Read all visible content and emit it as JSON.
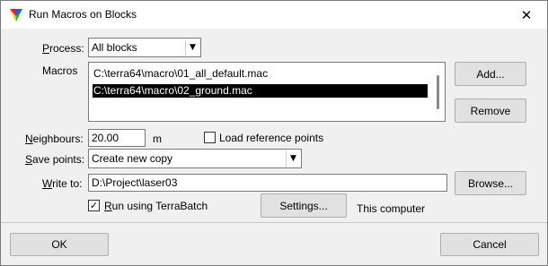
{
  "window": {
    "title": "Run Macros on Blocks",
    "close_glyph": "✕"
  },
  "process": {
    "label_accel": "P",
    "label_rest": "rocess:",
    "value": "All blocks"
  },
  "macros": {
    "label": "Macros",
    "items": [
      {
        "path": "C:\\terra64\\macro\\01_all_default.mac",
        "selected": false
      },
      {
        "path": "C:\\terra64\\macro\\02_ground.mac",
        "selected": true
      }
    ],
    "add_label": "Add...",
    "remove_label": "Remove"
  },
  "neighbours": {
    "label_accel": "N",
    "label_rest": "eighbours:",
    "value": "20.00",
    "unit": "m"
  },
  "load_reference": {
    "label": "Load reference points",
    "checked": false
  },
  "save_points": {
    "label_accel": "S",
    "label_rest": "ave points:",
    "value": "Create new copy"
  },
  "write_to": {
    "label_accel": "W",
    "label_rest": "rite to:",
    "value": "D:\\Project\\laser03",
    "browse_label": "Browse..."
  },
  "run_terrabatch": {
    "label_accel": "R",
    "label_rest": "un using TerraBatch",
    "checked": true,
    "check_glyph": "✓",
    "settings_label": "Settings...",
    "target_text": "This computer"
  },
  "footer": {
    "ok_label": "OK",
    "cancel_label": "Cancel"
  },
  "icons": {
    "dropdown_arrow": "▼"
  }
}
